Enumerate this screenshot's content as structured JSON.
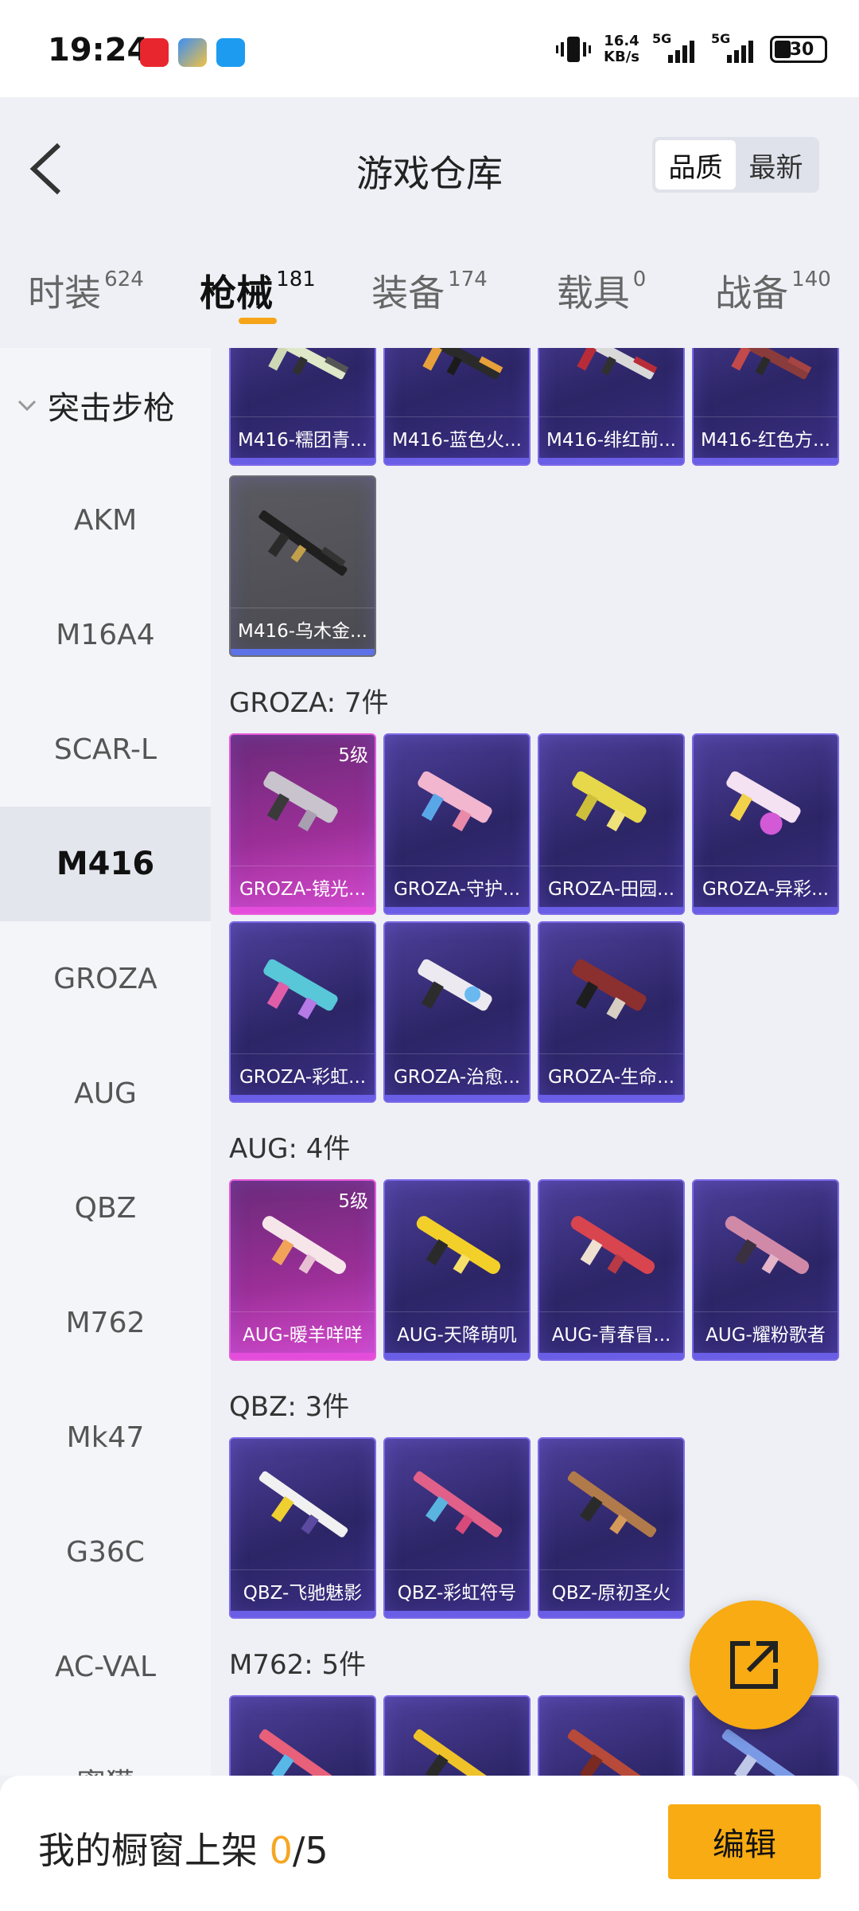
{
  "status_bar": {
    "time": "19:24",
    "net_speed_value": "16.4",
    "net_speed_unit": "KB/s",
    "signal1_label": "5G",
    "signal2_label": "5G",
    "battery": "30"
  },
  "header": {
    "title": "游戏仓库",
    "sort_options": [
      "品质",
      "最新"
    ],
    "active_sort": "品质"
  },
  "tabs": [
    {
      "label": "时装",
      "count": "624"
    },
    {
      "label": "枪械",
      "count": "181"
    },
    {
      "label": "装备",
      "count": "174"
    },
    {
      "label": "载具",
      "count": "0"
    },
    {
      "label": "战备",
      "count": "140"
    }
  ],
  "active_tab": "枪械",
  "sidebar": {
    "group": "突击步枪",
    "items": [
      "AKM",
      "M16A4",
      "SCAR-L",
      "M416",
      "GROZA",
      "AUG",
      "QBZ",
      "M762",
      "Mk47",
      "G36C",
      "AC-VAL",
      "蜜獾"
    ],
    "active_item": "M416"
  },
  "sections": {
    "m416_row1": [
      "M416-糯团青...",
      "M416-蓝色火...",
      "M416-绯红前...",
      "M416-红色方..."
    ],
    "m416_row2": [
      "M416-乌木金..."
    ],
    "groza": {
      "title": "GROZA: 7件",
      "level_badge": "5级",
      "items": [
        "GROZA-镜光...",
        "GROZA-守护...",
        "GROZA-田园...",
        "GROZA-异彩...",
        "GROZA-彩虹...",
        "GROZA-治愈...",
        "GROZA-生命..."
      ]
    },
    "aug": {
      "title": "AUG: 4件",
      "level_badge": "5级",
      "items": [
        "AUG-暖羊咩咩",
        "AUG-天降萌叽",
        "AUG-青春冒...",
        "AUG-耀粉歌者"
      ]
    },
    "qbz": {
      "title": "QBZ: 3件",
      "items": [
        "QBZ-飞驰魅影",
        "QBZ-彩虹符号",
        "QBZ-原初圣火"
      ]
    },
    "m762": {
      "title": "M762: 5件"
    }
  },
  "bottom": {
    "showcase_label": "我的橱窗上架",
    "showcase_current": "0",
    "showcase_total": "/5",
    "edit_label": "编辑"
  },
  "colors": {
    "accent": "#f8ab12",
    "card_purple": "#2c2566",
    "card_pink": "#d64ad0"
  }
}
